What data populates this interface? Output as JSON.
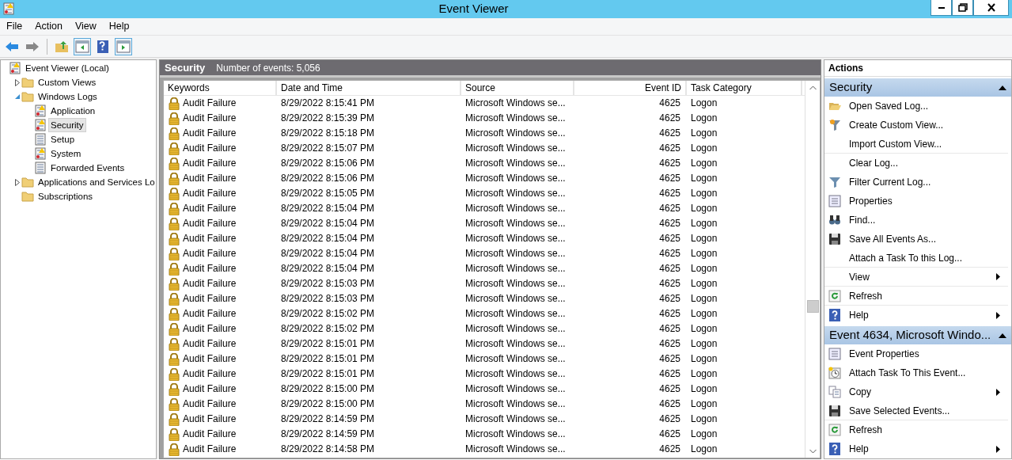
{
  "window": {
    "title": "Event Viewer"
  },
  "menu": [
    "File",
    "Action",
    "View",
    "Help"
  ],
  "tree": [
    {
      "label": "Event Viewer (Local)",
      "selected": false,
      "children": [
        {
          "label": "Custom Views",
          "selected": false,
          "expanded": false
        },
        {
          "label": "Windows Logs",
          "selected": false,
          "expanded": true,
          "children": [
            {
              "label": "Application",
              "selected": false
            },
            {
              "label": "Security",
              "selected": true
            },
            {
              "label": "Setup",
              "selected": false
            },
            {
              "label": "System",
              "selected": false
            },
            {
              "label": "Forwarded Events",
              "selected": false
            }
          ]
        },
        {
          "label": "Applications and Services Lo",
          "selected": false,
          "expanded": false
        },
        {
          "label": "Subscriptions",
          "selected": false
        }
      ]
    }
  ],
  "log_header": {
    "name": "Security",
    "count": "Number of events: 5,056"
  },
  "table": {
    "columns": [
      "Keywords",
      "Date and Time",
      "Source",
      "Event ID",
      "Task Category"
    ],
    "rows": [
      [
        "Audit Failure",
        "8/29/2022 8:15:41 PM",
        "Microsoft Windows se...",
        "4625",
        "Logon"
      ],
      [
        "Audit Failure",
        "8/29/2022 8:15:39 PM",
        "Microsoft Windows se...",
        "4625",
        "Logon"
      ],
      [
        "Audit Failure",
        "8/29/2022 8:15:18 PM",
        "Microsoft Windows se...",
        "4625",
        "Logon"
      ],
      [
        "Audit Failure",
        "8/29/2022 8:15:07 PM",
        "Microsoft Windows se...",
        "4625",
        "Logon"
      ],
      [
        "Audit Failure",
        "8/29/2022 8:15:06 PM",
        "Microsoft Windows se...",
        "4625",
        "Logon"
      ],
      [
        "Audit Failure",
        "8/29/2022 8:15:06 PM",
        "Microsoft Windows se...",
        "4625",
        "Logon"
      ],
      [
        "Audit Failure",
        "8/29/2022 8:15:05 PM",
        "Microsoft Windows se...",
        "4625",
        "Logon"
      ],
      [
        "Audit Failure",
        "8/29/2022 8:15:04 PM",
        "Microsoft Windows se...",
        "4625",
        "Logon"
      ],
      [
        "Audit Failure",
        "8/29/2022 8:15:04 PM",
        "Microsoft Windows se...",
        "4625",
        "Logon"
      ],
      [
        "Audit Failure",
        "8/29/2022 8:15:04 PM",
        "Microsoft Windows se...",
        "4625",
        "Logon"
      ],
      [
        "Audit Failure",
        "8/29/2022 8:15:04 PM",
        "Microsoft Windows se...",
        "4625",
        "Logon"
      ],
      [
        "Audit Failure",
        "8/29/2022 8:15:04 PM",
        "Microsoft Windows se...",
        "4625",
        "Logon"
      ],
      [
        "Audit Failure",
        "8/29/2022 8:15:03 PM",
        "Microsoft Windows se...",
        "4625",
        "Logon"
      ],
      [
        "Audit Failure",
        "8/29/2022 8:15:03 PM",
        "Microsoft Windows se...",
        "4625",
        "Logon"
      ],
      [
        "Audit Failure",
        "8/29/2022 8:15:02 PM",
        "Microsoft Windows se...",
        "4625",
        "Logon"
      ],
      [
        "Audit Failure",
        "8/29/2022 8:15:02 PM",
        "Microsoft Windows se...",
        "4625",
        "Logon"
      ],
      [
        "Audit Failure",
        "8/29/2022 8:15:01 PM",
        "Microsoft Windows se...",
        "4625",
        "Logon"
      ],
      [
        "Audit Failure",
        "8/29/2022 8:15:01 PM",
        "Microsoft Windows se...",
        "4625",
        "Logon"
      ],
      [
        "Audit Failure",
        "8/29/2022 8:15:01 PM",
        "Microsoft Windows se...",
        "4625",
        "Logon"
      ],
      [
        "Audit Failure",
        "8/29/2022 8:15:00 PM",
        "Microsoft Windows se...",
        "4625",
        "Logon"
      ],
      [
        "Audit Failure",
        "8/29/2022 8:15:00 PM",
        "Microsoft Windows se...",
        "4625",
        "Logon"
      ],
      [
        "Audit Failure",
        "8/29/2022 8:14:59 PM",
        "Microsoft Windows se...",
        "4625",
        "Logon"
      ],
      [
        "Audit Failure",
        "8/29/2022 8:14:59 PM",
        "Microsoft Windows se...",
        "4625",
        "Logon"
      ],
      [
        "Audit Failure",
        "8/29/2022 8:14:58 PM",
        "Microsoft Windows se...",
        "4625",
        "Logon"
      ]
    ]
  },
  "actions": {
    "title": "Actions",
    "sections": [
      {
        "title": "Security",
        "expanded": true,
        "items": [
          {
            "label": "Open Saved Log...",
            "submenu": false,
            "separator_after": false
          },
          {
            "label": "Create Custom View...",
            "submenu": false,
            "separator_after": false
          },
          {
            "label": "Import Custom View...",
            "submenu": false,
            "separator_after": true
          },
          {
            "label": "Clear Log...",
            "submenu": false,
            "separator_after": false
          },
          {
            "label": "Filter Current Log...",
            "submenu": false,
            "separator_after": false
          },
          {
            "label": "Properties",
            "submenu": false,
            "separator_after": false
          },
          {
            "label": "Find...",
            "submenu": false,
            "separator_after": false
          },
          {
            "label": "Save All Events As...",
            "submenu": false,
            "separator_after": false
          },
          {
            "label": "Attach a Task To this Log...",
            "submenu": false,
            "separator_after": true
          },
          {
            "label": "View",
            "submenu": true,
            "separator_after": true
          },
          {
            "label": "Refresh",
            "submenu": false,
            "separator_after": true
          },
          {
            "label": "Help",
            "submenu": true,
            "separator_after": false
          }
        ]
      },
      {
        "title": "Event 4634, Microsoft Windo...",
        "expanded": true,
        "items": [
          {
            "label": "Event Properties",
            "submenu": false,
            "separator_after": false
          },
          {
            "label": "Attach Task To This Event...",
            "submenu": false,
            "separator_after": false
          },
          {
            "label": "Copy",
            "submenu": true,
            "separator_after": false
          },
          {
            "label": "Save Selected Events...",
            "submenu": false,
            "separator_after": true
          },
          {
            "label": "Refresh",
            "submenu": false,
            "separator_after": false
          },
          {
            "label": "Help",
            "submenu": true,
            "separator_after": false
          }
        ]
      }
    ]
  }
}
